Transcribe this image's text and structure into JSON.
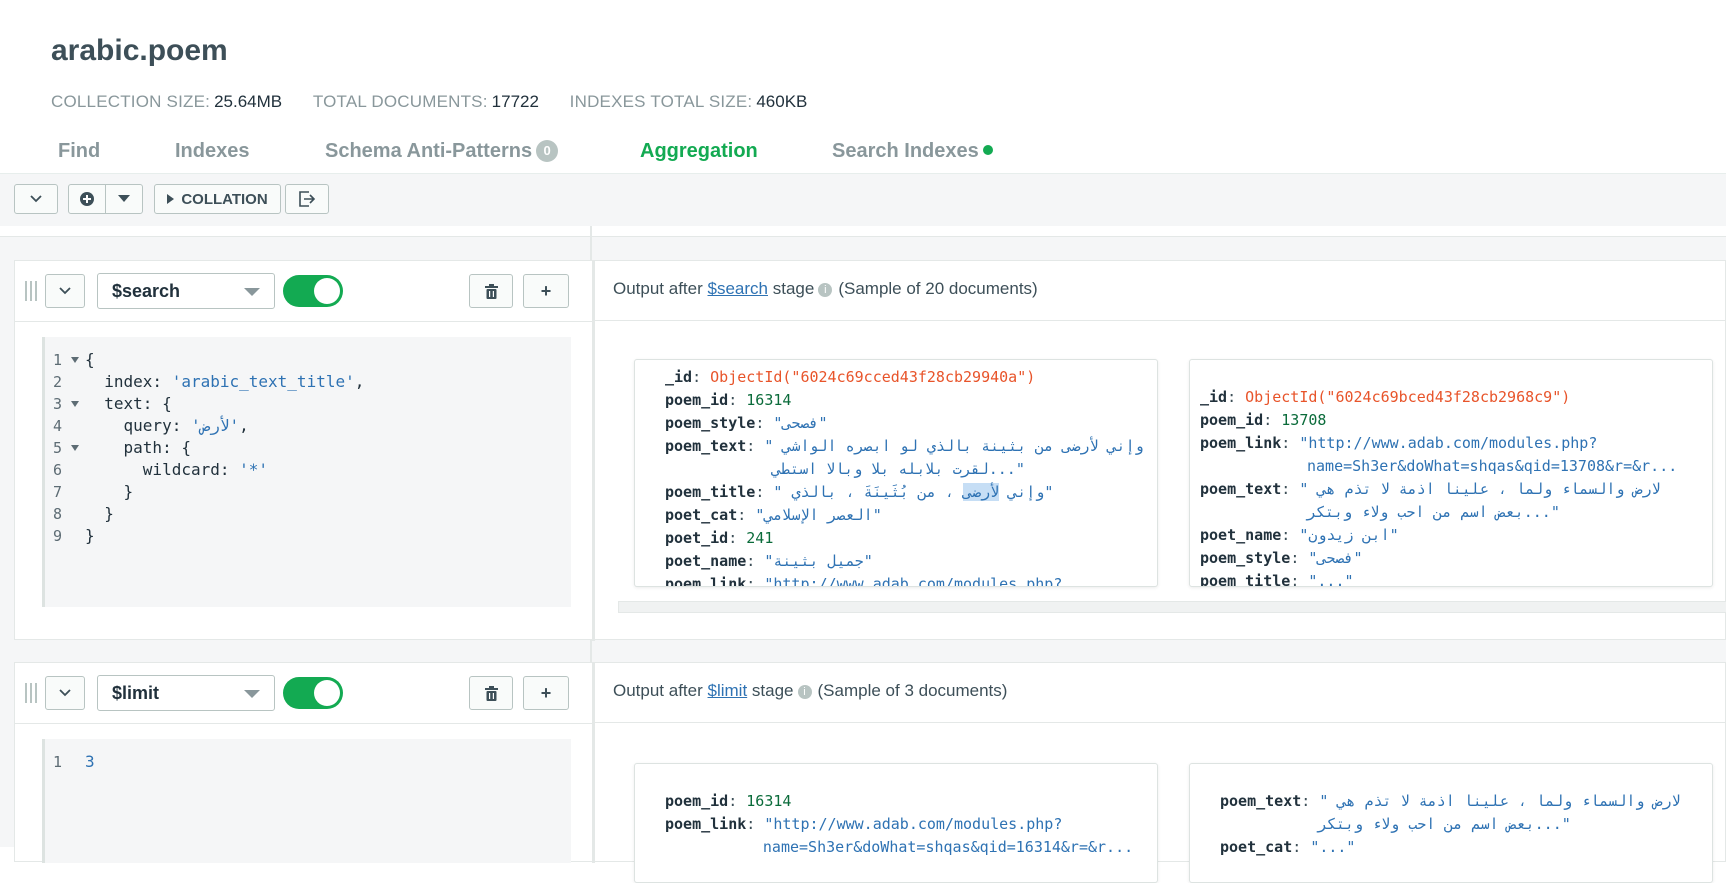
{
  "header": {
    "title": "arabic.poem",
    "stats": [
      {
        "label": "COLLECTION SIZE:",
        "value": "25.64MB"
      },
      {
        "label": "TOTAL DOCUMENTS:",
        "value": "17722"
      },
      {
        "label": "INDEXES TOTAL SIZE:",
        "value": "460KB"
      }
    ],
    "tabs": [
      {
        "label": "Find"
      },
      {
        "label": "Indexes"
      },
      {
        "label": "Schema Anti-Patterns",
        "badge": "0"
      },
      {
        "label": "Aggregation",
        "active": true
      },
      {
        "label": "Search Indexes",
        "status_dot": "#13aa52"
      }
    ]
  },
  "toolbar": {
    "collation_label": "COLLATION"
  },
  "stages": [
    {
      "operator": "$search",
      "enabled": true,
      "code_lines": [
        {
          "n": "1",
          "fold": true,
          "parts": [
            {
              "t": "{"
            }
          ]
        },
        {
          "n": "2",
          "parts": [
            {
              "t": "  index: "
            },
            {
              "t": "'arabic_text_title'",
              "s": true
            },
            {
              "t": ","
            }
          ]
        },
        {
          "n": "3",
          "fold": true,
          "parts": [
            {
              "t": "  text: {"
            }
          ]
        },
        {
          "n": "4",
          "parts": [
            {
              "t": "    query: "
            },
            {
              "t": "'لأرض'",
              "s": true
            },
            {
              "t": ","
            }
          ]
        },
        {
          "n": "5",
          "fold": true,
          "parts": [
            {
              "t": "    path: {"
            }
          ]
        },
        {
          "n": "6",
          "parts": [
            {
              "t": "      wildcard: "
            },
            {
              "t": "'*'",
              "s": true
            }
          ]
        },
        {
          "n": "7",
          "parts": [
            {
              "t": "    }"
            }
          ]
        },
        {
          "n": "8",
          "parts": [
            {
              "t": "  }"
            }
          ]
        },
        {
          "n": "9",
          "parts": [
            {
              "t": "}"
            }
          ]
        }
      ],
      "output": {
        "prefix": "Output after",
        "stage_link": "$search",
        "suffix": "stage",
        "sample": "(Sample of 20 documents)"
      },
      "documents": [
        {
          "fields": [
            {
              "key": "_id",
              "value": "ObjectId(\"6024c69cced43f28cb29940a\")",
              "type": "oid"
            },
            {
              "key": "poem_id",
              "value": "16314",
              "type": "num"
            },
            {
              "key": "poem_style",
              "value": "\"فصحى\"",
              "type": "str"
            },
            {
              "key": "poem_text",
              "value": "\" وإني لأرضى من بثينة بالذي لو ابصره الواشي",
              "type": "str",
              "cont": "لقرت بلابله بلا وبالا استطي...\""
            },
            {
              "key": "poem_title",
              "value": "\" وإني لأرضى ، من بُثَينَةَ ، بالذي\"",
              "type": "str",
              "highlight": "لأرضى"
            },
            {
              "key": "poet_cat",
              "value": "\"العصر الإسلامي\"",
              "type": "str"
            },
            {
              "key": "poet_id",
              "value": "241",
              "type": "num"
            },
            {
              "key": "poet_name",
              "value": "\"جميل بثينة\"",
              "type": "str"
            },
            {
              "key": "poem_link",
              "value": "\"http://www.adab.com/modules.php?",
              "type": "str"
            }
          ]
        },
        {
          "fields": [
            {
              "key": "_id",
              "value": "ObjectId(\"6024c69bced43f28cb2968c9\")",
              "type": "oid"
            },
            {
              "key": "poem_id",
              "value": "13708",
              "type": "num"
            },
            {
              "key": "poem_link",
              "value": "\"http://www.adab.com/modules.php?",
              "type": "str",
              "cont": "name=Sh3er&doWhat=shqas&qid=13708&r=&r..."
            },
            {
              "key": "poem_text",
              "value": "\" لارض والسماء ولما ، علينا اذمة لا تذم هي",
              "type": "str",
              "cont": "بعض اسم من احب ولاء وبتكر...\""
            },
            {
              "key": "poet_name",
              "value": "\"ابن زيدون\"",
              "type": "str"
            },
            {
              "key": "poem_style",
              "value": "\"فصحى\"",
              "type": "str"
            },
            {
              "key": "poem_title",
              "value": "\"...\"",
              "type": "str"
            }
          ]
        }
      ]
    },
    {
      "operator": "$limit",
      "enabled": true,
      "code_lines": [
        {
          "n": "1",
          "parts": [
            {
              "t": "3",
              "s": true
            }
          ]
        }
      ],
      "output": {
        "prefix": "Output after",
        "stage_link": "$limit",
        "suffix": "stage",
        "sample": "(Sample of 3 documents)"
      },
      "documents": [
        {
          "fields": [
            {
              "key": "poem_id",
              "value": "16314",
              "type": "num"
            },
            {
              "key": "poem_link",
              "value": "\"http://www.adab.com/modules.php?",
              "type": "str",
              "cont": "name=Sh3er&doWhat=shqas&qid=16314&r=&r..."
            }
          ]
        },
        {
          "fields": [
            {
              "key": "poem_text",
              "value": "\" لارض والسماء ولما ، علينا اذمة لا تذم هي",
              "type": "str",
              "cont": "بعض اسم من احب ولاء وبتكر...\""
            },
            {
              "key": "poet_cat",
              "value": "\"...\"",
              "type": "str"
            }
          ]
        }
      ]
    }
  ]
}
